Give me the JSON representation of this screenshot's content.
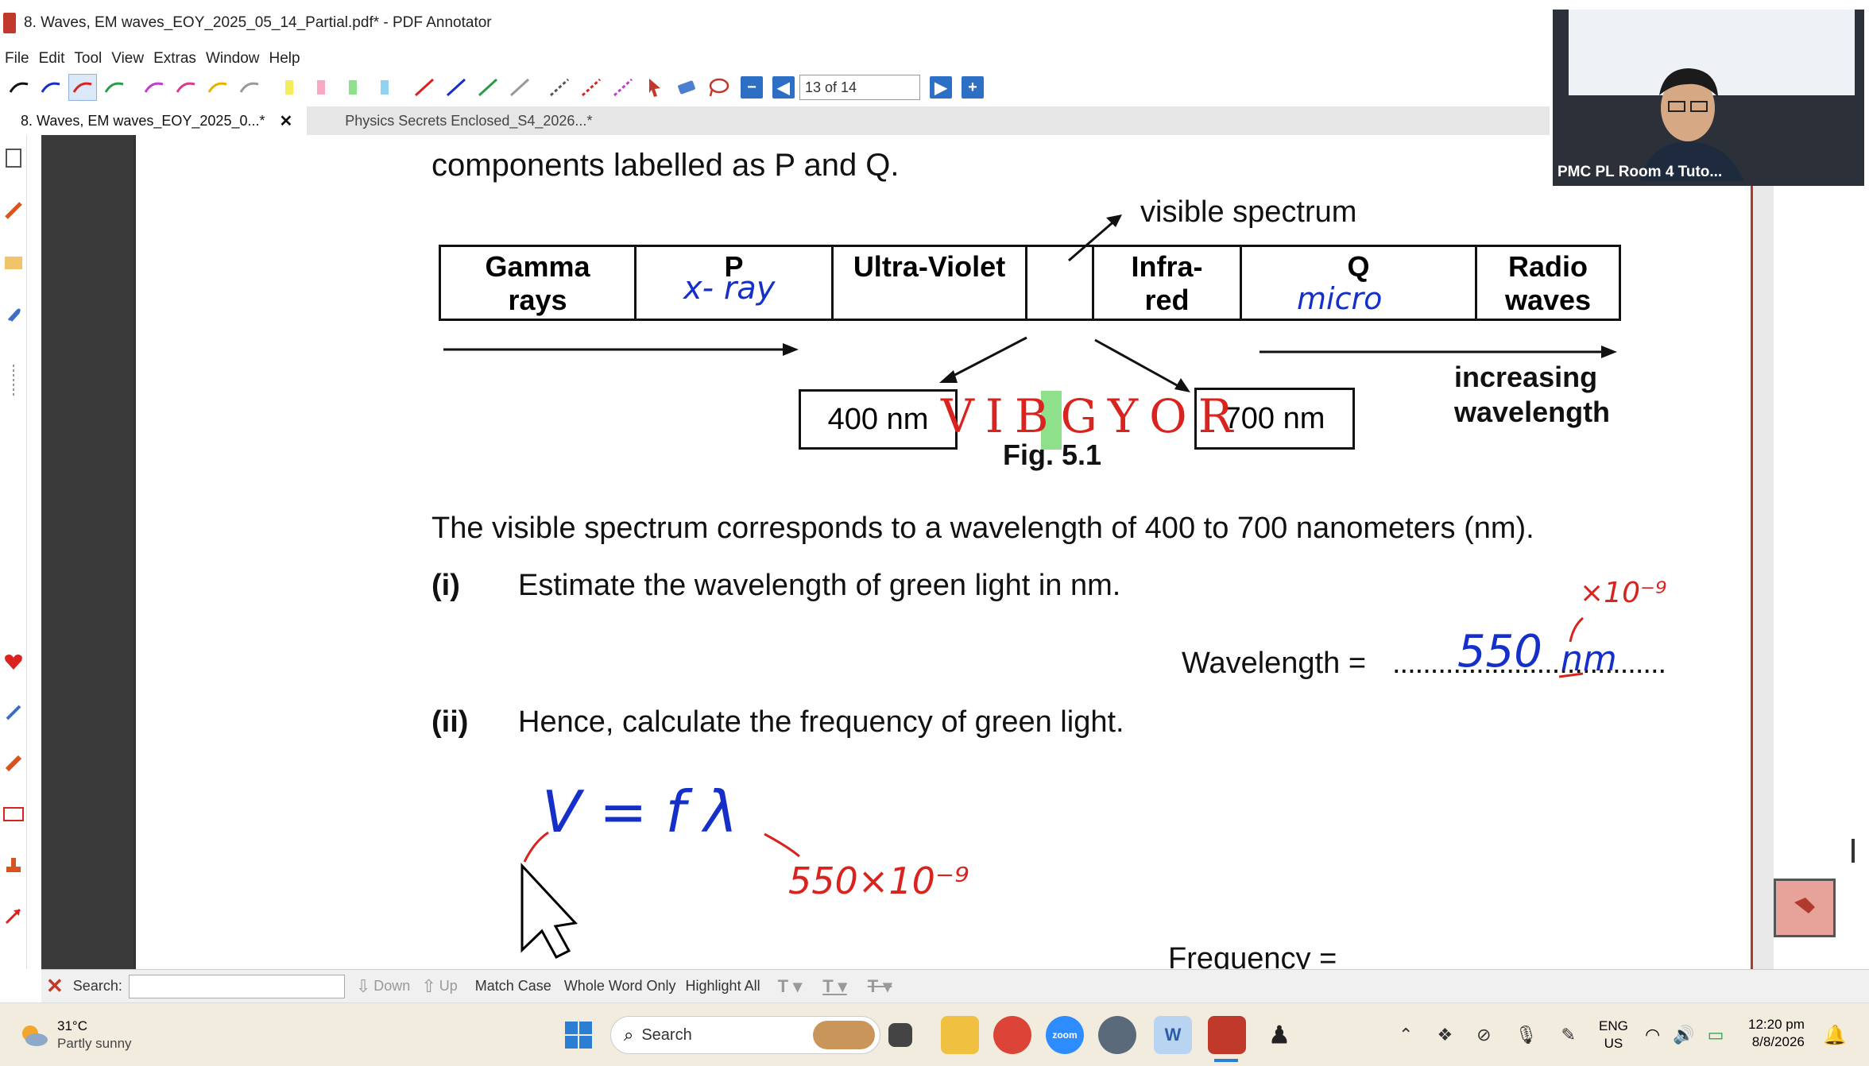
{
  "window": {
    "title": "8. Waves, EM waves_EOY_2025_05_14_Partial.pdf* - PDF Annotator"
  },
  "menu": [
    "File",
    "Edit",
    "Tool",
    "View",
    "Extras",
    "Window",
    "Help"
  ],
  "toolbar": {
    "page_indicator": "13 of 14"
  },
  "tabs": [
    {
      "label": "8. Waves, EM waves_EOY_2025_0...*",
      "active": true
    },
    {
      "label": "Physics Secrets Enclosed_S4_2026...*",
      "active": false
    }
  ],
  "document": {
    "intro": "components labelled as P and Q.",
    "visible_spectrum": "visible spectrum",
    "spectrum": [
      {
        "top": "Gamma",
        "bottom": "rays"
      },
      {
        "top": "P",
        "bottom": ""
      },
      {
        "top": "Ultra-Violet",
        "bottom": ""
      },
      {
        "top": "",
        "bottom": ""
      },
      {
        "top": "Infra-",
        "bottom": "red"
      },
      {
        "top": "Q",
        "bottom": ""
      },
      {
        "top": "Radio",
        "bottom": "waves"
      }
    ],
    "box_400": "400 nm",
    "box_700": "700 nm",
    "increasing_1": "increasing",
    "increasing_2": "wavelength",
    "fig": "Fig. 5.1",
    "body": "The visible spectrum corresponds to a wavelength of 400 to 700 nanometers (nm).",
    "q1_num": "(i)",
    "q1_text": "Estimate the wavelength of green light in nm.",
    "wavelength_label": "Wavelength = ",
    "wavelength_dots": "....................................",
    "q2_num": "(ii)",
    "q2_text": "Hence, calculate the frequency of green light.",
    "frequency_label": "Frequency ="
  },
  "annotations": {
    "p_answer": "x- ray",
    "q_answer": "micro",
    "vibgyor": [
      "V",
      "I",
      "B",
      "G",
      "Y",
      "O",
      "R"
    ],
    "wavelength_answer": "550",
    "unit": "nm",
    "exp": "×10⁻⁹",
    "formula": "V = f λ",
    "sub": "550×10⁻⁹"
  },
  "search": {
    "label": "Search:",
    "down": "Down",
    "up": "Up",
    "match_case": "Match Case",
    "whole_word": "Whole Word Only",
    "highlight_all": "Highlight All"
  },
  "taskbar": {
    "weather_temp": "31°C",
    "weather_desc": "Partly sunny",
    "search_placeholder": "Search",
    "lang_1": "ENG",
    "lang_2": "US",
    "time": "12:20 pm",
    "date": "8/8/2026"
  },
  "video": {
    "participant": "PMC PL Room 4 Tuto..."
  },
  "colors": {
    "accent": "#2e6fc6",
    "ink_red": "#d9231f",
    "ink_blue": "#1530c8",
    "highlight_green": "#8fe08a"
  }
}
